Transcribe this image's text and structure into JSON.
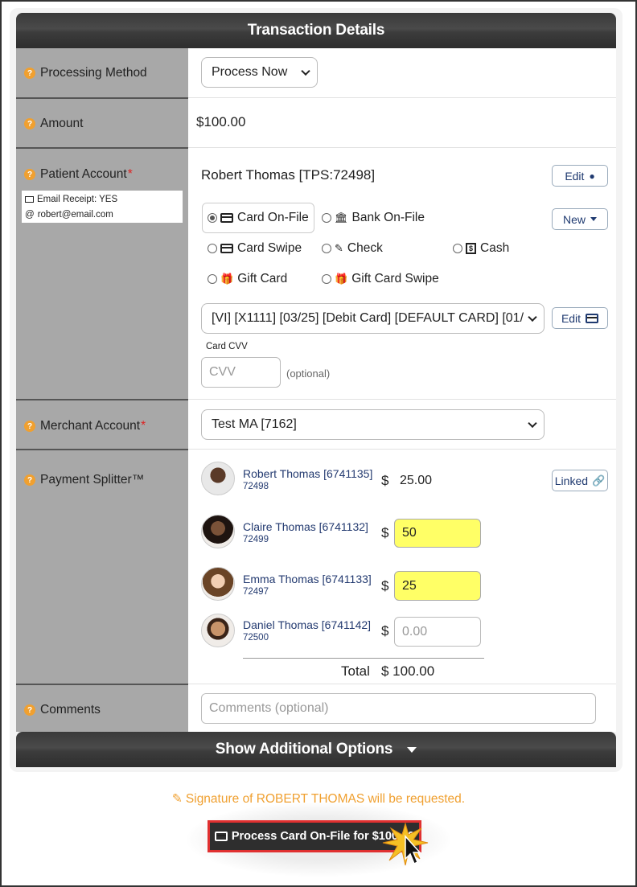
{
  "header": {
    "title": "Transaction Details"
  },
  "processing_method": {
    "label": "Processing Method",
    "selected": "Process Now"
  },
  "amount": {
    "label": "Amount",
    "value": "$100.00"
  },
  "patient_account": {
    "label": "Patient Account",
    "required_mark": "*",
    "email_receipt": "Email Receipt: YES",
    "email": "robert@email.com",
    "name": "Robert Thomas [TPS:72498]",
    "edit_label": "Edit",
    "new_label": "New",
    "payment_options": [
      {
        "label": "Card On-File",
        "selected": true
      },
      {
        "label": "Bank On-File",
        "selected": false
      },
      {
        "label": "Card Swipe",
        "selected": false
      },
      {
        "label": "Check",
        "selected": false
      },
      {
        "label": "Cash",
        "selected": false
      },
      {
        "label": "Gift Card",
        "selected": false
      },
      {
        "label": "Gift Card Swipe",
        "selected": false
      }
    ],
    "card_selected": "[VI] [X1111] [03/25] [Debit Card] [DEFAULT CARD] [01/",
    "card_edit_label": "Edit",
    "cvv_label": "Card CVV",
    "cvv_placeholder": "CVV",
    "cvv_hint": "(optional)"
  },
  "merchant_account": {
    "label": "Merchant Account",
    "required_mark": "*",
    "selected": "Test MA [7162]"
  },
  "payment_splitter": {
    "label": "Payment Splitter™",
    "linked_label": "Linked",
    "currency": "$",
    "people": [
      {
        "name": "Robert Thomas [6741135]",
        "id": "72498",
        "amount": "25.00",
        "kind": "text"
      },
      {
        "name": "Claire Thomas [6741132]",
        "id": "72499",
        "amount": "50",
        "kind": "yellow"
      },
      {
        "name": "Emma Thomas [6741133]",
        "id": "72497",
        "amount": "25",
        "kind": "yellow"
      },
      {
        "name": "Daniel Thomas [6741142]",
        "id": "72500",
        "amount": "0.00",
        "kind": "placeholder"
      }
    ],
    "total_label": "Total",
    "total_value": "$ 100.00"
  },
  "comments": {
    "label": "Comments",
    "placeholder": "Comments (optional)"
  },
  "additional": {
    "label": "Show Additional Options"
  },
  "signature_note": "Signature of ROBERT THOMAS will be requested.",
  "process_button": "Process Card On-File for $100.00",
  "colors": {
    "accent_orange": "#f0a030",
    "link_blue": "#233a70",
    "highlight_yellow": "#ffff66",
    "button_outline_red": "#e03030"
  }
}
